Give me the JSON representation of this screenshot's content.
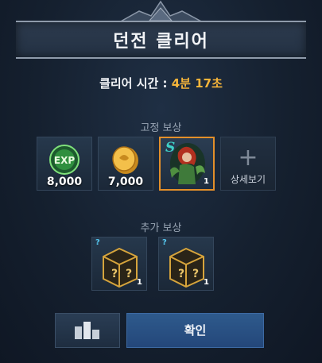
{
  "title": "던전 클리어",
  "clear_time": {
    "label": "클리어 시간 : ",
    "minutes": "4분",
    "seconds": "17초"
  },
  "fixed_reward": {
    "label": "고정 보상",
    "items": [
      {
        "icon": "exp-orb-icon",
        "quantity": "8,000"
      },
      {
        "icon": "gold-coin-icon",
        "quantity": "7,000"
      },
      {
        "icon": "character-card-icon",
        "grade": "S",
        "count": "1"
      }
    ],
    "detail_label": "상세보기"
  },
  "extra_reward": {
    "label": "추가 보상",
    "items": [
      {
        "icon": "mystery-box-icon",
        "mark": "?",
        "count": "1"
      },
      {
        "icon": "mystery-box-icon",
        "mark": "?",
        "count": "1"
      }
    ]
  },
  "buttons": {
    "ranking_icon": "ranking-bars-icon",
    "confirm_label": "확인"
  },
  "colors": {
    "accent_gold": "#f6b53a",
    "selected_border": "#e38f2a",
    "confirm_blue": "#2e5a8c"
  }
}
